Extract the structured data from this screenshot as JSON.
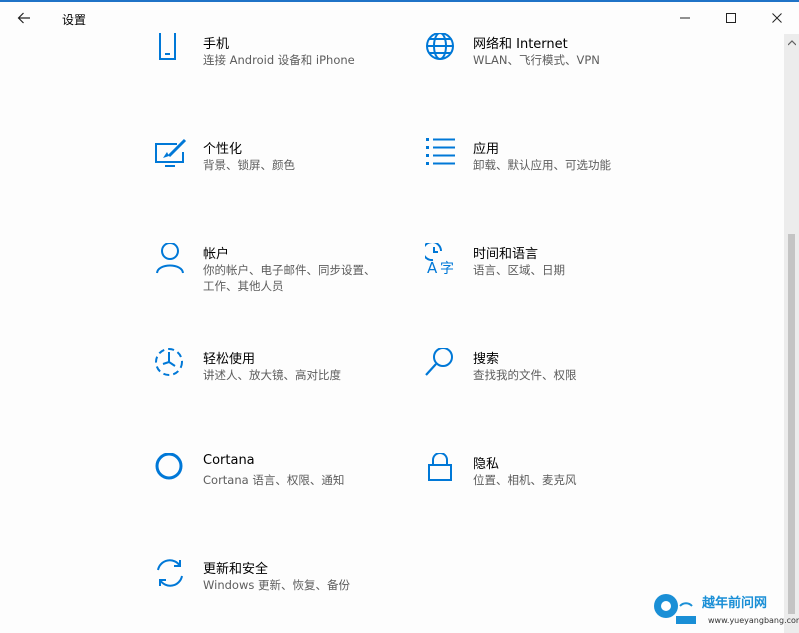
{
  "window": {
    "title": "设置"
  },
  "tiles": [
    {
      "label": "手机",
      "desc": "连接 Android 设备和 iPhone",
      "icon": "phone-icon"
    },
    {
      "label": "网络和 Internet",
      "desc": "WLAN、飞行模式、VPN",
      "icon": "globe-icon"
    },
    {
      "label": "个性化",
      "desc": "背景、锁屏、颜色",
      "icon": "personalization-icon"
    },
    {
      "label": "应用",
      "desc": "卸载、默认应用、可选功能",
      "icon": "apps-list-icon"
    },
    {
      "label": "帐户",
      "desc": "你的帐户、电子邮件、同步设置、工作、其他人员",
      "icon": "person-icon"
    },
    {
      "label": "时间和语言",
      "desc": "语言、区域、日期",
      "icon": "time-language-icon"
    },
    {
      "label": "轻松使用",
      "desc": "讲述人、放大镜、高对比度",
      "icon": "ease-of-access-icon"
    },
    {
      "label": "搜索",
      "desc": "查找我的文件、权限",
      "icon": "search-icon"
    },
    {
      "label": "Cortana",
      "desc": "Cortana 语言、权限、通知",
      "icon": "cortana-icon"
    },
    {
      "label": "隐私",
      "desc": "位置、相机、麦克风",
      "icon": "lock-icon"
    },
    {
      "label": "更新和安全",
      "desc": "Windows 更新、恢复、备份",
      "icon": "update-sync-icon"
    }
  ],
  "watermark": {
    "text": "越年前问网",
    "url": "www.yueyangbang.com"
  },
  "colors": {
    "accent": "#0078d7",
    "title_bar_line": "#1f73c7"
  }
}
